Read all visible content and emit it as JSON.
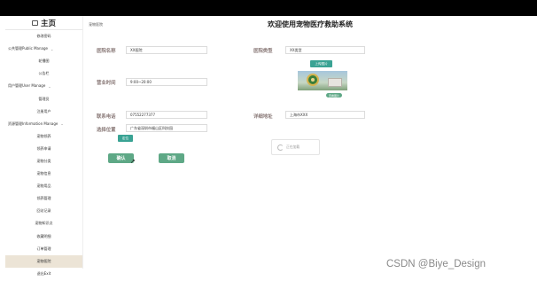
{
  "sidebar": {
    "title": "主页",
    "items": [
      {
        "label": "修改密码",
        "group": false,
        "active": false
      },
      {
        "label": "公共管理Public Manage",
        "group": true,
        "active": false
      },
      {
        "label": "轮播图",
        "group": false,
        "active": false
      },
      {
        "label": "公告栏",
        "group": false,
        "active": false
      },
      {
        "label": "用户管理User Manage",
        "group": true,
        "active": false
      },
      {
        "label": "管理员",
        "group": false,
        "active": false
      },
      {
        "label": "注册用户",
        "group": false,
        "active": false
      },
      {
        "label": "资源管理Information Manage",
        "group": true,
        "active": false
      },
      {
        "label": "宠物领养",
        "group": false,
        "active": false
      },
      {
        "label": "领养申请",
        "group": false,
        "active": false
      },
      {
        "label": "宠物分类",
        "group": false,
        "active": false
      },
      {
        "label": "宠物信息",
        "group": false,
        "active": false
      },
      {
        "label": "宠物用品",
        "group": false,
        "active": false
      },
      {
        "label": "领养管理",
        "group": false,
        "active": false
      },
      {
        "label": "回访记录",
        "group": false,
        "active": false
      },
      {
        "label": "宠物知识点",
        "group": false,
        "active": false
      },
      {
        "label": "收藏明细",
        "group": false,
        "active": false
      },
      {
        "label": "订单管理",
        "group": false,
        "active": false
      },
      {
        "label": "宠物医院",
        "group": false,
        "active": true
      },
      {
        "label": "退出Exit",
        "group": false,
        "active": false
      }
    ],
    "group_chevron": "⌄"
  },
  "header": {
    "breadcrumb": "宠物医院",
    "title": "欢迎使用宠物医疗救助系统"
  },
  "form": {
    "hospital_name_label": "医院名称",
    "hospital_name_value": "XX医院",
    "hospital_type_label": "医院类型",
    "hospital_type_value": "XX类型",
    "upload_label": "上传图片",
    "image_badge": "查看图片",
    "business_hours_label": "营业时间",
    "business_hours_value": "9:00~20:00",
    "phone_label": "联系电话",
    "phone_value": "07552277377",
    "address_label": "详细地址",
    "address_value": "上海市XXX",
    "location_label": "选择位置",
    "location_value": "广东省深圳市福山区科技园",
    "locate_button": "定位",
    "captcha_text": "正在加载",
    "confirm_button": "确认",
    "cancel_button": "取消"
  },
  "watermark": "CSDN @Biye_Design",
  "colors": {
    "topbar": "#000000",
    "label": "#8a7a78",
    "primary_button": "#5ea886",
    "small_button": "#3aa394",
    "active_sidebar": "#ece4d6"
  }
}
